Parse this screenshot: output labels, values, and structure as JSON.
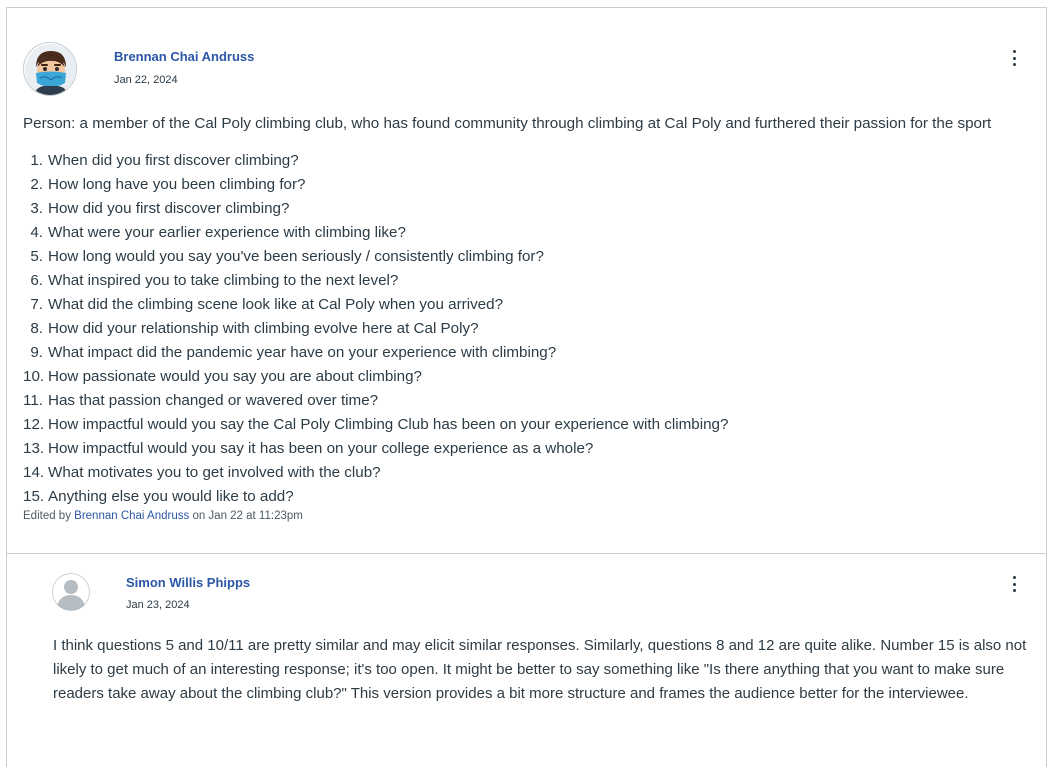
{
  "main_post": {
    "author": "Brennan Chai Andruss",
    "date": "Jan 22, 2024",
    "intro": "Person: a member of the Cal Poly climbing club, who has found community through climbing at Cal Poly and furthered their passion for the sport",
    "questions": [
      {
        "num": "1.",
        "text": "When did you first discover climbing?"
      },
      {
        "num": "2.",
        "text": "How long have you been climbing for?"
      },
      {
        "num": "3.",
        "text": "How did you first discover climbing?"
      },
      {
        "num": "4.",
        "text": "What were your earlier experience with climbing like?"
      },
      {
        "num": "5.",
        "text": "How long would you say you've been seriously / consistently climbing for?"
      },
      {
        "num": "6.",
        "text": "What inspired you to take climbing to the next level?"
      },
      {
        "num": "7.",
        "text": "What did the climbing scene look like at Cal Poly when you arrived?"
      },
      {
        "num": "8.",
        "text": "How did your relationship with climbing evolve here at Cal Poly?"
      },
      {
        "num": "9.",
        "text": "What impact did the pandemic year have on your experience with climbing?"
      },
      {
        "num": "10.",
        "text": "How passionate would you say you are about climbing?"
      },
      {
        "num": "11.",
        "text": "Has that passion changed or wavered over time?"
      },
      {
        "num": "12.",
        "text": "How impactful would you say the Cal Poly Climbing Club has been on your experience with climbing?"
      },
      {
        "num": "13.",
        "text": "How impactful would you say it has been on your college experience as a whole?"
      },
      {
        "num": "14.",
        "text": "What motivates you to get involved with the club?"
      },
      {
        "num": "15.",
        "text": "Anything else you would like to add?"
      }
    ],
    "edited_prefix": "Edited by",
    "edited_by": "Brennan Chai Andruss",
    "edited_suffix": "on Jan 22 at 11:23pm"
  },
  "reply": {
    "author": "Simon Willis Phipps",
    "date": "Jan 23, 2024",
    "body": "I think questions 5 and 10/11 are pretty similar and may elicit similar responses. Similarly, questions 8 and 12 are quite alike. Number 15 is also not likely to get much of an interesting response; it's too open. It might be better to say something like \"Is there anything that you want to make sure readers take away about the climbing club?\" This version provides a bit more structure and frames the audience better for the interviewee."
  },
  "colors": {
    "link": "#2b57a6",
    "text": "#2d3b45",
    "border": "#c7cdd1"
  },
  "icons": {
    "main_avatar": "avatar-cartoon-icon",
    "reply_avatar": "default-user-icon",
    "menu": "kebab-menu-icon"
  }
}
